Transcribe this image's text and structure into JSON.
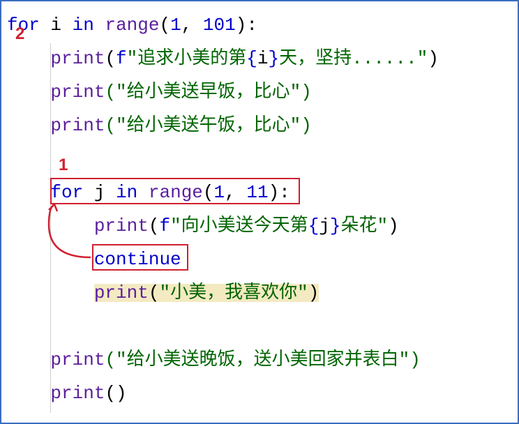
{
  "annotations": {
    "label1": "1",
    "label2": "2"
  },
  "code": {
    "line1": {
      "kw_for": "for",
      "var_i": "i",
      "kw_in": "in",
      "fn_range": "range",
      "lparen": "(",
      "num1": "1",
      "comma": ", ",
      "num2": "101",
      "rparen": "):"
    },
    "line2": {
      "fn": "print",
      "lparen": "(",
      "fprefix": "f",
      "q1": "\"",
      "s1": "追求小美的第",
      "lb": "{",
      "var": "i",
      "rb": "}",
      "s2": "天，坚持......",
      "q2": "\"",
      "rparen": ")"
    },
    "line3": {
      "fn": "print",
      "arg": "(\"给小美送早饭，比心\")"
    },
    "line4": {
      "fn": "print",
      "arg": "(\"给小美送午饭，比心\")"
    },
    "line6": {
      "kw_for": "for",
      "var_j": "j",
      "kw_in": "in",
      "fn_range": "range",
      "lparen": "(",
      "num1": "1",
      "comma": ", ",
      "num2": "11",
      "rparen": "):"
    },
    "line7": {
      "fn": "print",
      "lparen": "(",
      "fprefix": "f",
      "q1": "\"",
      "s1": "向小美送今天第",
      "lb": "{",
      "var": "j",
      "rb": "}",
      "s2": "朵花",
      "q2": "\"",
      "rparen": ")"
    },
    "line8": {
      "kw": "continue"
    },
    "line9": {
      "fn": "print",
      "lparen": "(",
      "q1": "\"",
      "s1": "小美，我喜欢你",
      "q2": "\"",
      "rparen": ")"
    },
    "line11": {
      "fn": "print",
      "arg": "(\"给小美送晚饭，送小美回家并表白\")"
    },
    "line12": {
      "fn": "print",
      "arg": "()"
    }
  }
}
